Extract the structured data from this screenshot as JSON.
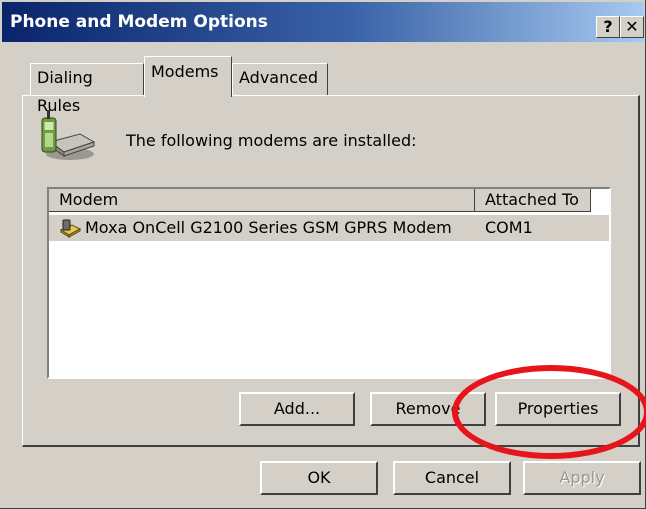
{
  "window": {
    "title": "Phone and Modem Options",
    "help_label": "?",
    "close_label": "✕"
  },
  "tabs": [
    {
      "label": "Dialing Rules",
      "active": false
    },
    {
      "label": "Modems",
      "active": true
    },
    {
      "label": "Advanced",
      "active": false
    }
  ],
  "modems_page": {
    "heading": "The following modems are installed:",
    "icon": "phone-modem-icon",
    "columns": [
      "Modem",
      "Attached To"
    ],
    "rows": [
      {
        "icon": "modem-icon",
        "modem": "Moxa OnCell G2100 Series GSM GPRS Modem",
        "attached_to": "COM1",
        "selected": true
      }
    ],
    "buttons": {
      "add": "Add...",
      "remove": "Remove",
      "properties": "Properties"
    }
  },
  "footer": {
    "ok": "OK",
    "cancel": "Cancel",
    "apply": "Apply",
    "apply_enabled": false
  },
  "annotation": {
    "shape": "ellipse",
    "color": "#e8141b",
    "target": "properties-button"
  }
}
